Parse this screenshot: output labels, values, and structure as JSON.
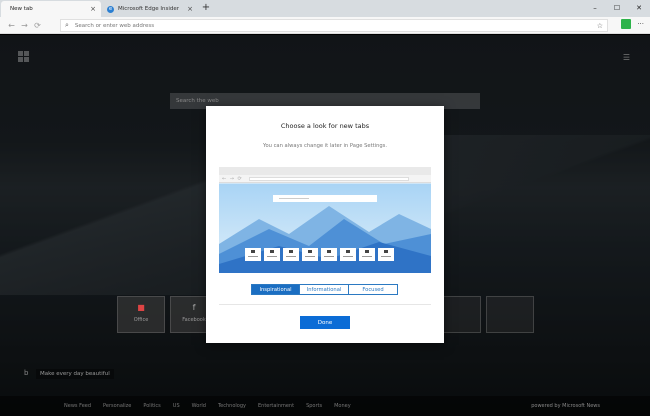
{
  "tabs": [
    {
      "label": "New tab",
      "close": "×"
    },
    {
      "label": "Microsoft Edge Insider",
      "icon": "edge-logo-icon",
      "close": "×"
    }
  ],
  "new_tab": "+",
  "window_controls": [
    "–",
    "☐",
    "✕"
  ],
  "address": {
    "placeholder": "Search or enter web address"
  },
  "icons": {
    "back": "←",
    "forward": "→",
    "refresh": "⟳",
    "search": "⌕",
    "favorite": "☆",
    "more": "···"
  },
  "page": {
    "search_placeholder": "Search the web",
    "quick_links": [
      {
        "label": "Office",
        "icon": "office-icon"
      },
      {
        "label": "Facebook",
        "icon": "facebook-icon",
        "glyph": "f"
      }
    ],
    "tagline": "Make every day beautiful",
    "news_items": [
      "News Feed",
      "Personalize",
      "Politics",
      "US",
      "World",
      "Technology",
      "Entertainment",
      "Sports",
      "Money"
    ],
    "powered_by": "powered by Microsoft News"
  },
  "modal": {
    "title": "Choose a look for new tabs",
    "subtitle": "You can always change it later in Page Settings.",
    "options": [
      "Inspirational",
      "Informational",
      "Focused"
    ],
    "selected": "Inspirational",
    "done": "Done"
  },
  "colors": {
    "accent": "#0b6cd6",
    "insider": "#2db34a"
  }
}
